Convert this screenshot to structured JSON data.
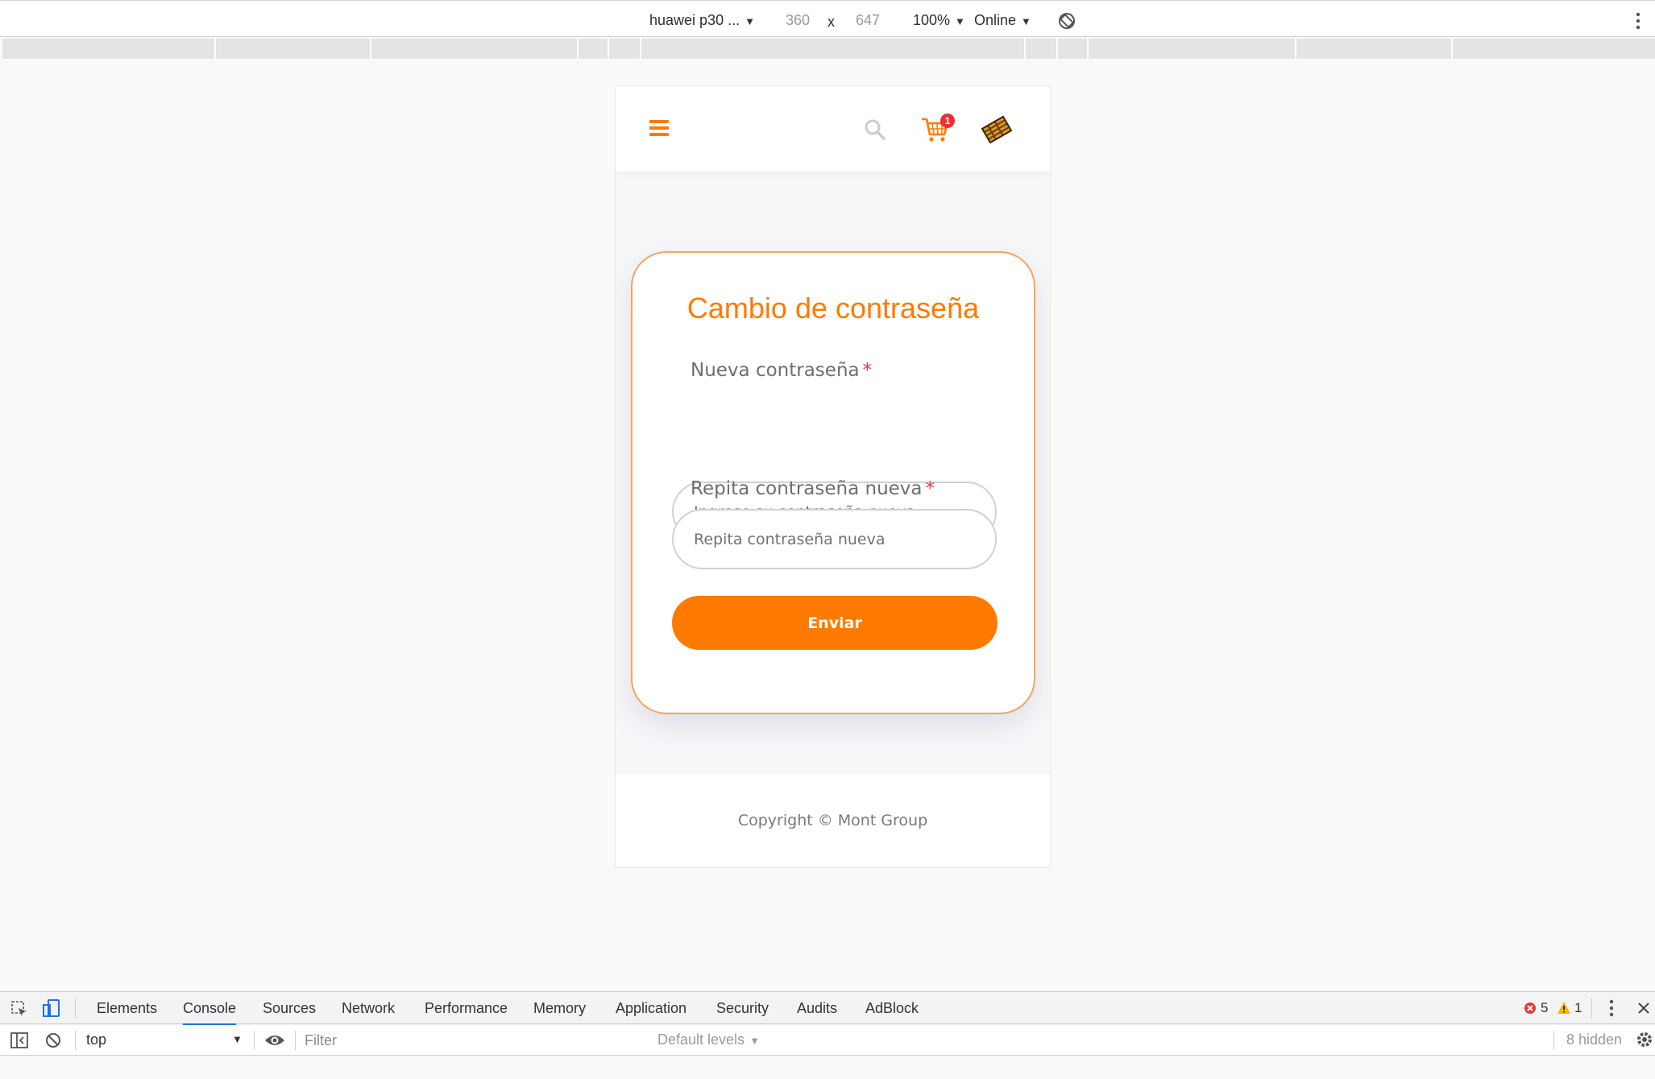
{
  "device_toolbar": {
    "device": "huawei p30 ...",
    "width": "360",
    "times": "x",
    "height": "647",
    "zoom": "100%",
    "throttle": "Online"
  },
  "app": {
    "brand_color": "#ff7a00",
    "cart_count": "1",
    "card": {
      "title": "Cambio de contraseña",
      "new_password_label": "Nueva contraseña",
      "new_password_placeholder": "Ingrese su contraseña nueva",
      "repeat_password_label": "Repita contraseña nueva",
      "repeat_password_placeholder": "Repita contraseña nueva",
      "required_mark": "*",
      "submit_label": "Enviar"
    },
    "footer": {
      "copyright": "Copyright © Mont Group"
    }
  },
  "devtools": {
    "tabs": [
      "Elements",
      "Console",
      "Sources",
      "Network",
      "Performance",
      "Memory",
      "Application",
      "Security",
      "Audits",
      "AdBlock"
    ],
    "active_tab": "Console",
    "error_count": "5",
    "warning_count": "1",
    "context": "top",
    "filter_placeholder": "Filter",
    "levels": "Default levels",
    "hidden": "8 hidden"
  }
}
